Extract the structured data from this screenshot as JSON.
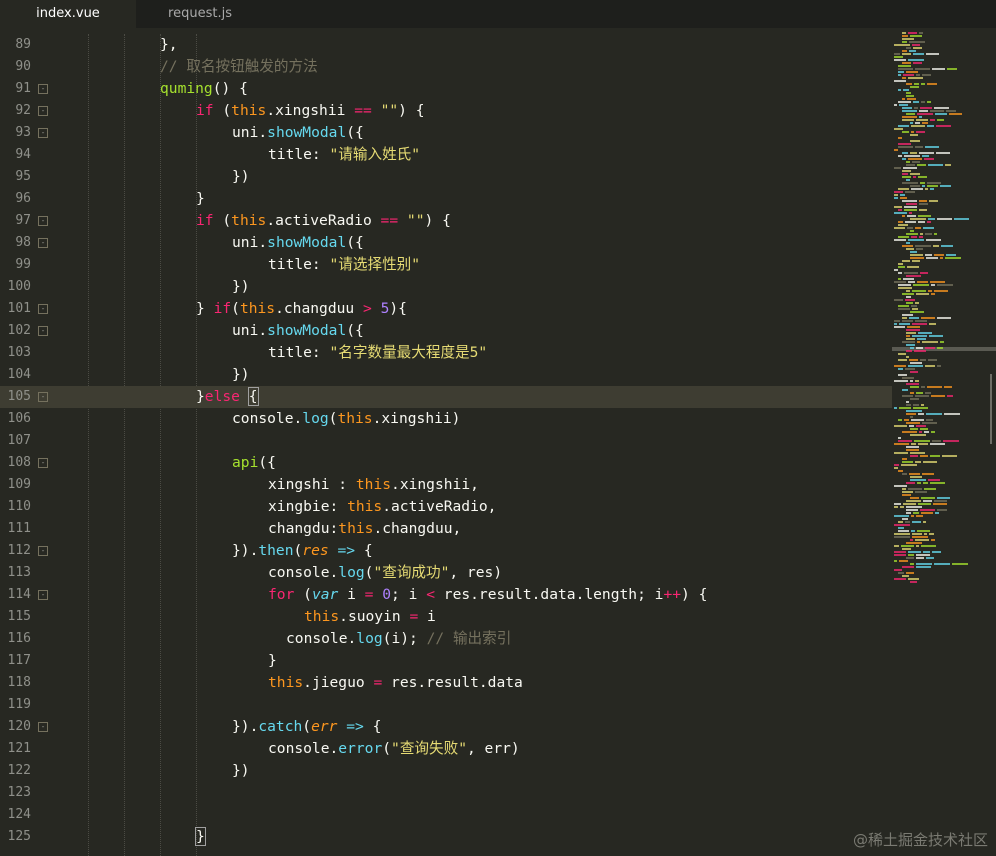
{
  "tabs": [
    {
      "label": "index.vue",
      "active": true
    },
    {
      "label": "request.js",
      "active": false
    }
  ],
  "editor": {
    "current_line": 105,
    "lines": [
      {
        "n": "89",
        "fold": false,
        "indent": 0,
        "tokens": [
          [
            "p",
            "},"
          ]
        ]
      },
      {
        "n": "90",
        "fold": false,
        "indent": 0,
        "tokens": [
          [
            "c",
            "// 取名按钮触发的方法"
          ]
        ]
      },
      {
        "n": "91",
        "fold": true,
        "indent": 0,
        "tokens": [
          [
            "g",
            "quming"
          ],
          [
            "p",
            "() {"
          ]
        ]
      },
      {
        "n": "92",
        "fold": true,
        "indent": 1,
        "tokens": [
          [
            "k",
            "if"
          ],
          [
            "p",
            " ("
          ],
          [
            "t",
            "this"
          ],
          [
            "p",
            ".xingshii "
          ],
          [
            "k",
            "=="
          ],
          [
            "p",
            " "
          ],
          [
            "s",
            "\"\""
          ],
          [
            "p",
            ") {"
          ]
        ]
      },
      {
        "n": "93",
        "fold": true,
        "indent": 2,
        "tokens": [
          [
            "p",
            "uni."
          ],
          [
            "f",
            "showModal"
          ],
          [
            "p",
            "({"
          ]
        ]
      },
      {
        "n": "94",
        "fold": false,
        "indent": 3,
        "tokens": [
          [
            "p",
            "title: "
          ],
          [
            "s",
            "\"请输入姓氏\""
          ]
        ]
      },
      {
        "n": "95",
        "fold": false,
        "indent": 2,
        "tokens": [
          [
            "p",
            "})"
          ]
        ]
      },
      {
        "n": "96",
        "fold": false,
        "indent": 1,
        "tokens": [
          [
            "p",
            "}"
          ]
        ]
      },
      {
        "n": "97",
        "fold": true,
        "indent": 1,
        "tokens": [
          [
            "k",
            "if"
          ],
          [
            "p",
            " ("
          ],
          [
            "t",
            "this"
          ],
          [
            "p",
            ".activeRadio "
          ],
          [
            "k",
            "=="
          ],
          [
            "p",
            " "
          ],
          [
            "s",
            "\"\""
          ],
          [
            "p",
            ") {"
          ]
        ]
      },
      {
        "n": "98",
        "fold": true,
        "indent": 2,
        "tokens": [
          [
            "p",
            "uni."
          ],
          [
            "f",
            "showModal"
          ],
          [
            "p",
            "({"
          ]
        ]
      },
      {
        "n": "99",
        "fold": false,
        "indent": 3,
        "tokens": [
          [
            "p",
            "title: "
          ],
          [
            "s",
            "\"请选择性别\""
          ]
        ]
      },
      {
        "n": "100",
        "fold": false,
        "indent": 2,
        "tokens": [
          [
            "p",
            "})"
          ]
        ]
      },
      {
        "n": "101",
        "fold": true,
        "indent": 1,
        "tokens": [
          [
            "p",
            "} "
          ],
          [
            "k",
            "if"
          ],
          [
            "p",
            "("
          ],
          [
            "t",
            "this"
          ],
          [
            "p",
            ".changduu "
          ],
          [
            "k",
            ">"
          ],
          [
            "p",
            " "
          ],
          [
            "n",
            "5"
          ],
          [
            "p",
            "){"
          ]
        ]
      },
      {
        "n": "102",
        "fold": true,
        "indent": 2,
        "tokens": [
          [
            "p",
            "uni."
          ],
          [
            "f",
            "showModal"
          ],
          [
            "p",
            "({"
          ]
        ]
      },
      {
        "n": "103",
        "fold": false,
        "indent": 3,
        "tokens": [
          [
            "p",
            "title: "
          ],
          [
            "s",
            "\"名字数量最大程度是5\""
          ]
        ]
      },
      {
        "n": "104",
        "fold": false,
        "indent": 2,
        "tokens": [
          [
            "p",
            "})"
          ]
        ]
      },
      {
        "n": "105",
        "fold": true,
        "indent": 1,
        "tokens": [
          [
            "p",
            "}"
          ],
          [
            "k",
            "else"
          ],
          [
            "p",
            " "
          ],
          [
            "cur",
            "{"
          ]
        ]
      },
      {
        "n": "106",
        "fold": false,
        "indent": 2,
        "tokens": [
          [
            "p",
            "console."
          ],
          [
            "f",
            "log"
          ],
          [
            "p",
            "("
          ],
          [
            "t",
            "this"
          ],
          [
            "p",
            ".xingshii)"
          ]
        ]
      },
      {
        "n": "107",
        "fold": false,
        "indent": 0,
        "tokens": []
      },
      {
        "n": "108",
        "fold": true,
        "indent": 2,
        "tokens": [
          [
            "g",
            "api"
          ],
          [
            "p",
            "({"
          ]
        ]
      },
      {
        "n": "109",
        "fold": false,
        "indent": 3,
        "tokens": [
          [
            "p",
            "xingshi : "
          ],
          [
            "t",
            "this"
          ],
          [
            "p",
            ".xingshii,"
          ]
        ]
      },
      {
        "n": "110",
        "fold": false,
        "indent": 3,
        "tokens": [
          [
            "p",
            "xingbie: "
          ],
          [
            "t",
            "this"
          ],
          [
            "p",
            ".activeRadio,"
          ]
        ]
      },
      {
        "n": "111",
        "fold": false,
        "indent": 3,
        "tokens": [
          [
            "p",
            "changdu:"
          ],
          [
            "t",
            "this"
          ],
          [
            "p",
            ".changduu,"
          ]
        ]
      },
      {
        "n": "112",
        "fold": true,
        "indent": 2,
        "tokens": [
          [
            "p",
            "})."
          ],
          [
            "f",
            "then"
          ],
          [
            "p",
            "("
          ],
          [
            "ti",
            "res"
          ],
          [
            "p",
            " "
          ],
          [
            "f",
            "=>"
          ],
          [
            "p",
            " {"
          ]
        ]
      },
      {
        "n": "113",
        "fold": false,
        "indent": 3,
        "tokens": [
          [
            "p",
            "console."
          ],
          [
            "f",
            "log"
          ],
          [
            "p",
            "("
          ],
          [
            "s",
            "\"查询成功\""
          ],
          [
            "p",
            ", res)"
          ]
        ]
      },
      {
        "n": "114",
        "fold": true,
        "indent": 3,
        "tokens": [
          [
            "k",
            "for"
          ],
          [
            "p",
            " ("
          ],
          [
            "fi",
            "var"
          ],
          [
            "p",
            " i "
          ],
          [
            "k",
            "="
          ],
          [
            "p",
            " "
          ],
          [
            "n",
            "0"
          ],
          [
            "p",
            "; i "
          ],
          [
            "k",
            "<"
          ],
          [
            "p",
            " res.result.data.length; i"
          ],
          [
            "k",
            "++"
          ],
          [
            "p",
            ") {"
          ]
        ]
      },
      {
        "n": "115",
        "fold": false,
        "indent": 4,
        "tokens": [
          [
            "t",
            "this"
          ],
          [
            "p",
            ".suoyin "
          ],
          [
            "k",
            "="
          ],
          [
            "p",
            " i"
          ]
        ]
      },
      {
        "n": "116",
        "fold": false,
        "indent": 3,
        "extra": "  ",
        "tokens": [
          [
            "p",
            "console."
          ],
          [
            "f",
            "log"
          ],
          [
            "p",
            "(i); "
          ],
          [
            "c",
            "// 输出索引"
          ]
        ]
      },
      {
        "n": "117",
        "fold": false,
        "indent": 3,
        "tokens": [
          [
            "p",
            "}"
          ]
        ]
      },
      {
        "n": "118",
        "fold": false,
        "indent": 3,
        "tokens": [
          [
            "t",
            "this"
          ],
          [
            "p",
            ".jieguo "
          ],
          [
            "k",
            "="
          ],
          [
            "p",
            " res.result.data"
          ]
        ]
      },
      {
        "n": "119",
        "fold": false,
        "indent": 0,
        "tokens": []
      },
      {
        "n": "120",
        "fold": true,
        "indent": 2,
        "tokens": [
          [
            "p",
            "})."
          ],
          [
            "f",
            "catch"
          ],
          [
            "p",
            "("
          ],
          [
            "ti",
            "err"
          ],
          [
            "p",
            " "
          ],
          [
            "f",
            "=>"
          ],
          [
            "p",
            " {"
          ]
        ]
      },
      {
        "n": "121",
        "fold": false,
        "indent": 3,
        "tokens": [
          [
            "p",
            "console."
          ],
          [
            "f",
            "error"
          ],
          [
            "p",
            "("
          ],
          [
            "s",
            "\"查询失败\""
          ],
          [
            "p",
            ", err)"
          ]
        ]
      },
      {
        "n": "122",
        "fold": false,
        "indent": 2,
        "tokens": [
          [
            "p",
            "})"
          ]
        ]
      },
      {
        "n": "123",
        "fold": false,
        "indent": 0,
        "tokens": []
      },
      {
        "n": "124",
        "fold": false,
        "indent": 0,
        "tokens": []
      },
      {
        "n": "125",
        "fold": false,
        "indent": 1,
        "tokens": [
          [
            "cur",
            "}"
          ]
        ]
      }
    ]
  },
  "minimap": {
    "palette": [
      "#a6e22e",
      "#e6db74",
      "#66d9ef",
      "#f92672",
      "#f8f8f2",
      "#fd971f",
      "#75715e"
    ]
  },
  "watermark": "@稀土掘金技术社区"
}
